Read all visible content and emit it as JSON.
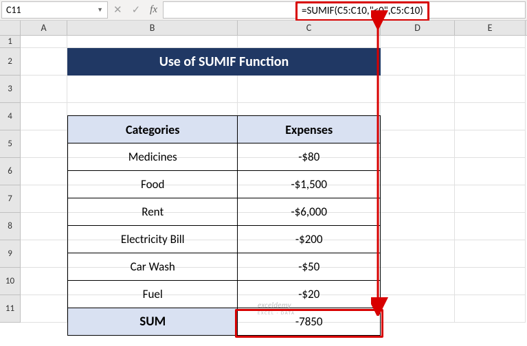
{
  "name_box": {
    "value": "C11"
  },
  "formula_bar": {
    "formula": "=SUMIF(C5:C10,\"<0\",C5:C10)"
  },
  "columns": [
    "A",
    "B",
    "C",
    "D",
    "E"
  ],
  "row_numbers": [
    "1",
    "2",
    "3",
    "4",
    "5",
    "6",
    "7",
    "8",
    "9",
    "10",
    "11"
  ],
  "title": "Use of SUMIF Function",
  "headers": {
    "cat": "Categories",
    "exp": "Expenses"
  },
  "rows": [
    {
      "cat": "Medicines",
      "exp": "-$80"
    },
    {
      "cat": "Food",
      "exp": "-$1,500"
    },
    {
      "cat": "Rent",
      "exp": "-$6,000"
    },
    {
      "cat": "Electricity Bill",
      "exp": "-$200"
    },
    {
      "cat": "Car Wash",
      "exp": "-$50"
    },
    {
      "cat": "Fuel",
      "exp": "-$20"
    }
  ],
  "sum_row": {
    "label": "SUM",
    "value": "-7850"
  },
  "watermark": {
    "main": "exceldemy",
    "sub": "EXCEL · DATA"
  },
  "chart_data": {
    "type": "table",
    "title": "Use of SUMIF Function",
    "columns": [
      "Categories",
      "Expenses"
    ],
    "rows": [
      [
        "Medicines",
        -80
      ],
      [
        "Food",
        -1500
      ],
      [
        "Rent",
        -6000
      ],
      [
        "Electricity Bill",
        -200
      ],
      [
        "Car Wash",
        -50
      ],
      [
        "Fuel",
        -20
      ]
    ],
    "sum": -7850,
    "formula": "=SUMIF(C5:C10,\"<0\",C5:C10)"
  }
}
